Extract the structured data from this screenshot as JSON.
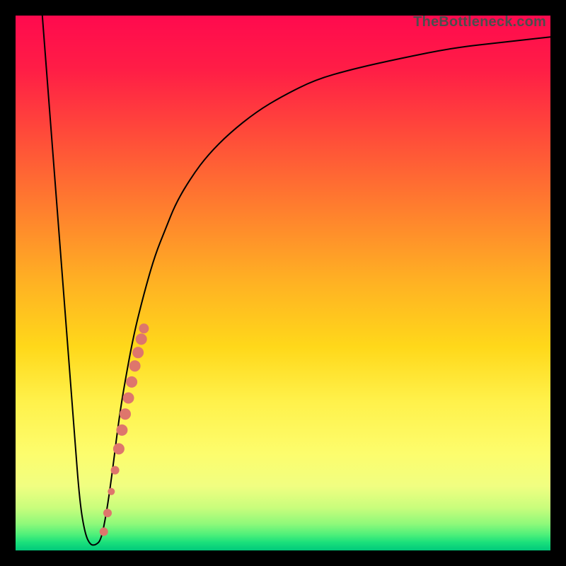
{
  "watermark": "TheBottleneck.com",
  "colors": {
    "border": "#000000",
    "curve": "#000000",
    "dots": "#de766c"
  },
  "chart_data": {
    "type": "line",
    "title": "",
    "xlabel": "",
    "ylabel": "",
    "xlim": [
      0,
      100
    ],
    "ylim": [
      0,
      100
    ],
    "grid": false,
    "legend": false,
    "series": [
      {
        "name": "bottleneck-curve",
        "x": [
          5,
          9,
          11,
          12,
          13,
          14,
          15,
          16,
          17,
          18,
          19,
          20,
          22,
          24,
          26,
          28,
          30,
          33,
          36,
          40,
          45,
          50,
          56,
          63,
          72,
          82,
          91,
          100
        ],
        "values": [
          100,
          48,
          22,
          9,
          3,
          1,
          1,
          2,
          7,
          14,
          22,
          29,
          40,
          48,
          55,
          60,
          65,
          70,
          74,
          78,
          82,
          85,
          88,
          90,
          92,
          94,
          95,
          96
        ]
      }
    ],
    "scatter": {
      "name": "highlight-dots",
      "points": [
        {
          "x": 16.5,
          "y": 3.5,
          "r": 6
        },
        {
          "x": 17.2,
          "y": 7.0,
          "r": 6
        },
        {
          "x": 17.9,
          "y": 11.0,
          "r": 5
        },
        {
          "x": 18.6,
          "y": 15.0,
          "r": 6
        },
        {
          "x": 19.3,
          "y": 19.0,
          "r": 8
        },
        {
          "x": 19.9,
          "y": 22.5,
          "r": 8
        },
        {
          "x": 20.5,
          "y": 25.5,
          "r": 8
        },
        {
          "x": 21.1,
          "y": 28.5,
          "r": 8
        },
        {
          "x": 21.7,
          "y": 31.5,
          "r": 8
        },
        {
          "x": 22.3,
          "y": 34.5,
          "r": 8
        },
        {
          "x": 22.9,
          "y": 37.0,
          "r": 8
        },
        {
          "x": 23.5,
          "y": 39.5,
          "r": 8
        },
        {
          "x": 24.0,
          "y": 41.5,
          "r": 7
        }
      ]
    },
    "annotations": []
  }
}
